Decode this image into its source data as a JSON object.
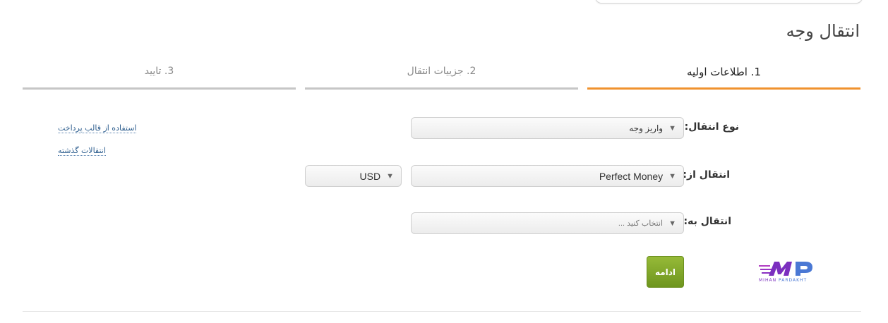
{
  "page": {
    "title": "انتقال وجه"
  },
  "steps": [
    {
      "label": "1. اطلاعات اولیه",
      "active": true
    },
    {
      "label": "2. جزییات انتقال",
      "active": false
    },
    {
      "label": "3. تایید",
      "active": false
    }
  ],
  "form": {
    "transfer_type_label": "نوع انتقال:",
    "transfer_type_value": "واریز وجه",
    "transfer_from_label": "انتقال از:",
    "transfer_from_value": "Perfect Money",
    "currency_value": "USD",
    "transfer_to_label": "انتقال به:",
    "transfer_to_placeholder": "انتخاب کنید ..."
  },
  "links": {
    "use_payment_template": "استفاده از قالب پرداخت",
    "past_transfers": "انتقالات گذشته"
  },
  "buttons": {
    "continue": "ادامه"
  },
  "logo": {
    "brand_part1": "MIHAN",
    "brand_part2": "PARDAKHT"
  },
  "colors": {
    "active_step": "#f0922e",
    "inactive_step": "#c6c6c6",
    "continue_button": "#7fa52a",
    "link": "#2f5f8f",
    "logo_purple": "#7b2fbf",
    "logo_blue": "#4a78d4"
  },
  "icons": {
    "select_arrow": "caret-down-icon"
  }
}
